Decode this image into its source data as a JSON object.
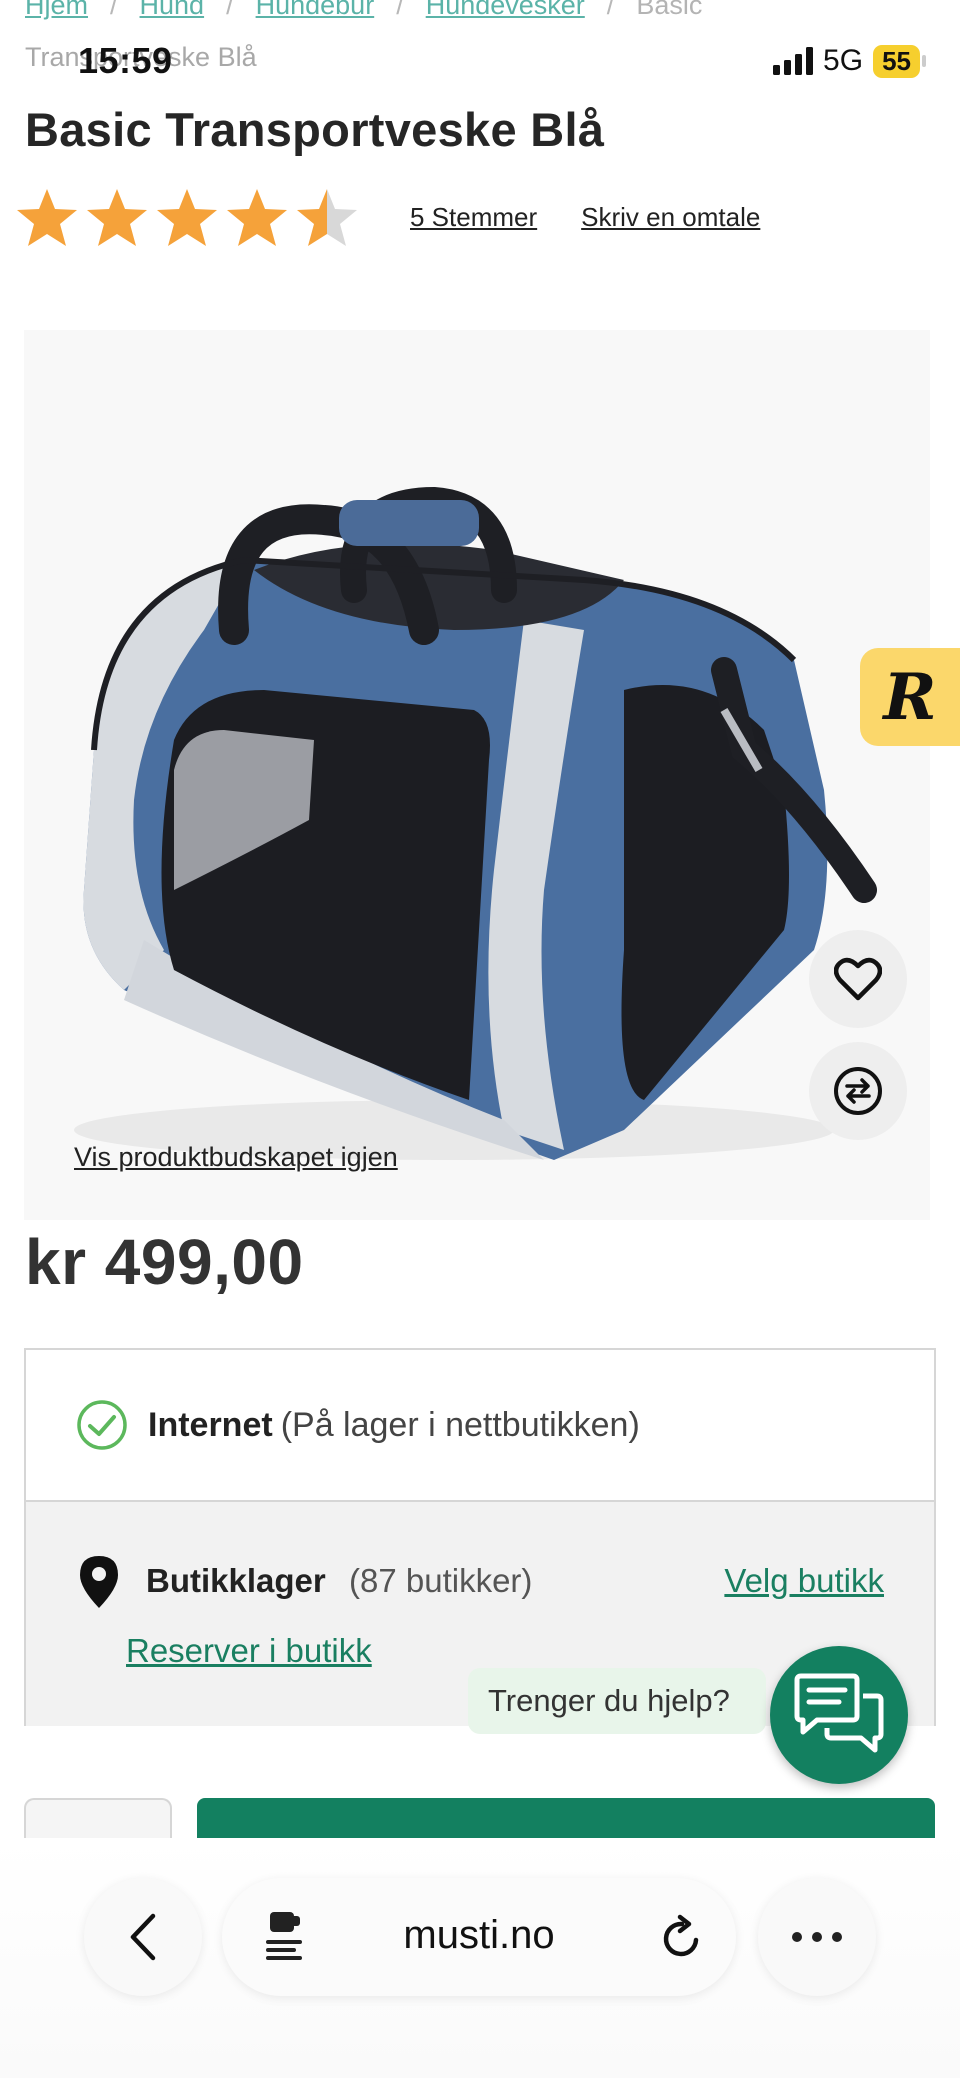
{
  "status_bar": {
    "time": "15:59",
    "network": "5G",
    "battery": "55"
  },
  "breadcrumb": {
    "items": [
      "Hjem",
      "Hund",
      "Hundebur",
      "Hundevesker"
    ],
    "current": "Basic",
    "current_cont": "Transportveske Blå",
    "separator": "/"
  },
  "product": {
    "title": "Basic Transportveske Blå",
    "rating": 4.5,
    "rating_max": 5,
    "votes_label": "5 Stemmer",
    "review_label": "Skriv en omtale",
    "show_message_label": "Vis produktbudskapet igjen",
    "price": "kr 499,00"
  },
  "stock": {
    "internet_label": "Internet",
    "internet_status": "(På lager i nettbutikken)",
    "store_label": "Butikklager",
    "store_count": "(87 butikker)",
    "choose_store": "Velg butikk",
    "reserve_in_store": "Reserver i butikk"
  },
  "badge": {
    "letter": "R"
  },
  "help": {
    "label": "Trenger du hjelp?"
  },
  "browser": {
    "url": "musti.no"
  },
  "colors": {
    "accent": "#138060",
    "star": "#f5a23a",
    "star_empty": "#d8d8d8",
    "check": "#5cb85c"
  }
}
